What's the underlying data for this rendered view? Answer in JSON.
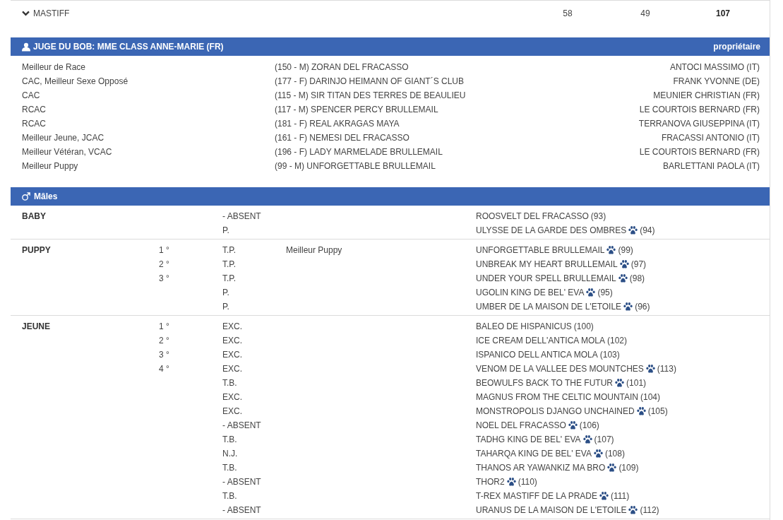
{
  "breed_row": {
    "name": "MASTIFF",
    "expanded": true,
    "count_1": "58",
    "count_2": "49",
    "total": "107"
  },
  "bob_panel": {
    "title": "JUGE DU BOB: MME CLASS ANNE-MARIE (FR)",
    "column_header": "propriétaire",
    "awards": [
      {
        "award": "Meilleur de Race",
        "dog": "(150 - M) ZORAN DEL FRACASSO",
        "owner": "ANTOCI MASSIMO (IT)"
      },
      {
        "award": "CAC, Meilleur Sexe Opposé",
        "dog": "(177 - F) DARINJO HEIMANN OF GIANT´S CLUB",
        "owner": "FRANK YVONNE (DE)"
      },
      {
        "award": "CAC",
        "dog": "(115 - M) SIR TITAN DES TERRES DE BEAULIEU",
        "owner": "MEUNIER CHRISTIAN (FR)"
      },
      {
        "award": "RCAC",
        "dog": "(117 - M) SPENCER PERCY BRULLEMAIL",
        "owner": "LE COURTOIS BERNARD (FR)"
      },
      {
        "award": "RCAC",
        "dog": "(181 - F) REAL AKRAGAS MAYA",
        "owner": "TERRANOVA GIUSEPPINA (IT)"
      },
      {
        "award": "Meilleur Jeune, JCAC",
        "dog": "(161 - F) NEMESI DEL FRACASSO",
        "owner": "FRACASSI ANTONIO (IT)"
      },
      {
        "award": "Meilleur Vétéran, VCAC",
        "dog": "(196 - F) LADY MARMELADE BRULLEMAIL",
        "owner": "LE COURTOIS BERNARD (FR)"
      },
      {
        "award": "Meilleur Puppy",
        "dog": "(99 - M) UNFORGETTABLE BRULLEMAIL",
        "owner": "BARLETTANI PAOLA (IT)"
      }
    ]
  },
  "males_panel": {
    "title": "Mâles",
    "classes": [
      {
        "name": "BABY",
        "entries": [
          {
            "grade": "- ABSENT",
            "dog": "ROOSVELT DEL FRACASSO",
            "number": "(93)",
            "paw": false
          },
          {
            "grade": "P.",
            "dog": "ULYSSE DE LA GARDE DES OMBRES",
            "number": "(94)",
            "paw": true
          }
        ]
      },
      {
        "name": "PUPPY",
        "entries": [
          {
            "place": "1 °",
            "grade": "T.P.",
            "award": "Meilleur Puppy",
            "dog": "UNFORGETTABLE BRULLEMAIL",
            "number": "(99)",
            "paw": true
          },
          {
            "place": "2 °",
            "grade": "T.P.",
            "dog": "UNBREAK MY HEART BRULLEMAIL",
            "number": "(97)",
            "paw": true
          },
          {
            "place": "3 °",
            "grade": "T.P.",
            "dog": "UNDER YOUR SPELL BRULLEMAIL",
            "number": "(98)",
            "paw": true
          },
          {
            "grade": "P.",
            "dog": "UGOLIN KING DE BEL' EVA",
            "number": "(95)",
            "paw": true
          },
          {
            "grade": "P.",
            "dog": "UMBER DE LA MAISON DE L'ETOILE",
            "number": "(96)",
            "paw": true
          }
        ]
      },
      {
        "name": "JEUNE",
        "entries": [
          {
            "place": "1 °",
            "grade": "EXC.",
            "dog": "BALEO DE HISPANICUS",
            "number": "(100)",
            "paw": false
          },
          {
            "place": "2 °",
            "grade": "EXC.",
            "dog": "ICE CREAM DELL'ANTICA MOLA",
            "number": "(102)",
            "paw": false
          },
          {
            "place": "3 °",
            "grade": "EXC.",
            "dog": "ISPANICO DELL ANTICA MOLA",
            "number": "(103)",
            "paw": false
          },
          {
            "place": "4 °",
            "grade": "EXC.",
            "dog": "VENOM DE LA VALLEE DES MOUNTCHES",
            "number": "(113)",
            "paw": true
          },
          {
            "grade": "T.B.",
            "dog": "BEOWULFS BACK TO THE FUTUR",
            "number": "(101)",
            "paw": true
          },
          {
            "grade": "EXC.",
            "dog": "MAGNUS FROM THE CELTIC MOUNTAIN",
            "number": "(104)",
            "paw": false
          },
          {
            "grade": "EXC.",
            "dog": "MONSTROPOLIS DJANGO UNCHAINED",
            "number": "(105)",
            "paw": true
          },
          {
            "grade": "- ABSENT",
            "dog": "NOEL DEL FRACASSO",
            "number": "(106)",
            "paw": true
          },
          {
            "grade": "T.B.",
            "dog": "TADHG KING DE BEL' EVA",
            "number": "(107)",
            "paw": true
          },
          {
            "grade": "N.J.",
            "dog": "TAHARQA KING DE BEL' EVA",
            "number": "(108)",
            "paw": true
          },
          {
            "grade": "T.B.",
            "dog": "THANOS AR YAWANKIZ MA BRO",
            "number": "(109)",
            "paw": true
          },
          {
            "grade": "- ABSENT",
            "dog": "THOR2",
            "number": "(110)",
            "paw": true
          },
          {
            "grade": "T.B.",
            "dog": "T-REX MASTIFF DE LA PRADE",
            "number": "(111)",
            "paw": true
          },
          {
            "grade": "- ABSENT",
            "dog": "URANUS DE LA MAISON DE L'ETOILE",
            "number": "(112)",
            "paw": true
          }
        ]
      }
    ]
  }
}
